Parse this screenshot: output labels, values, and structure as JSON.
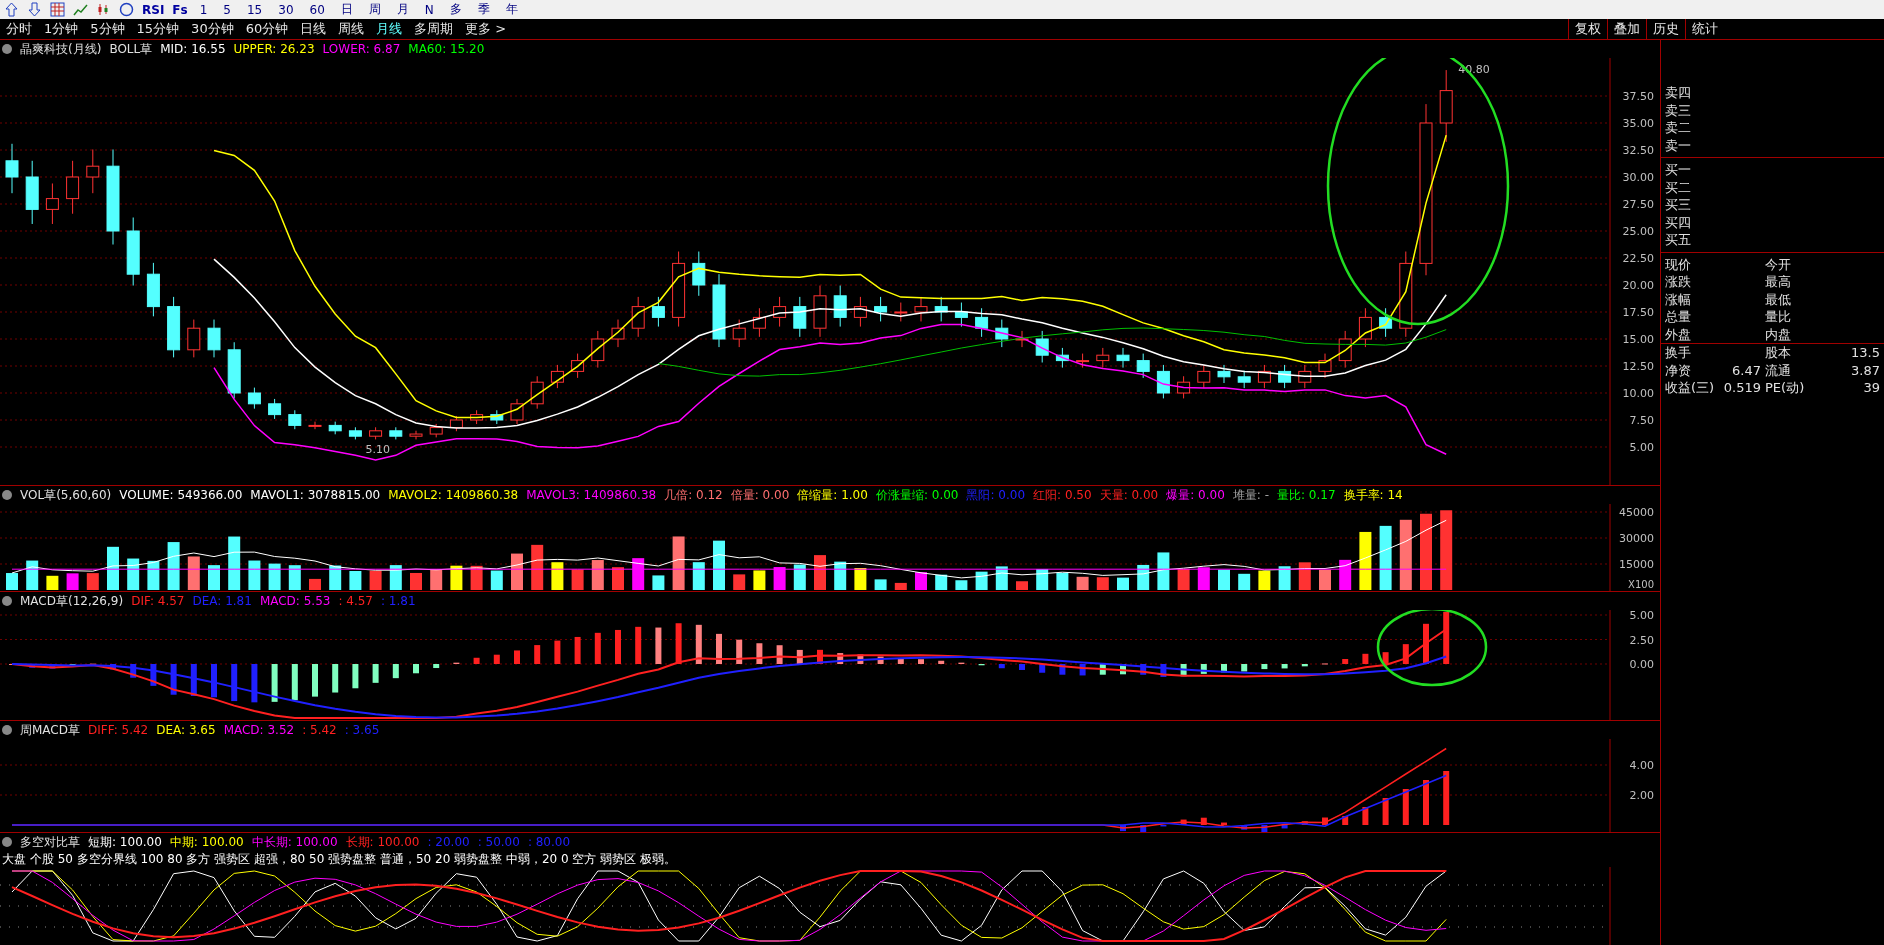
{
  "toolbar": {
    "labels": [
      "RSI",
      "Fs"
    ],
    "buttons": [
      "1",
      "5",
      "15",
      "30",
      "60",
      "日",
      "周",
      "月",
      "N",
      "多",
      "季",
      "年"
    ]
  },
  "periods": [
    {
      "label": "分时",
      "selected": false
    },
    {
      "label": "1分钟",
      "selected": false
    },
    {
      "label": "5分钟",
      "selected": false
    },
    {
      "label": "15分钟",
      "selected": false
    },
    {
      "label": "30分钟",
      "selected": false
    },
    {
      "label": "60分钟",
      "selected": false
    },
    {
      "label": "日线",
      "selected": false
    },
    {
      "label": "周线",
      "selected": false
    },
    {
      "label": "月线",
      "selected": true
    },
    {
      "label": "多周期",
      "selected": false
    },
    {
      "label": "更多 >",
      "selected": false
    }
  ],
  "right_tabs": [
    "复权",
    "叠加",
    "历史",
    "统计"
  ],
  "main_chart": {
    "stock": "晶爽科技(月线)",
    "indicator": "BOLL草",
    "values": [
      {
        "text": "MID: 16.55",
        "color": "#ffffff"
      },
      {
        "text": "UPPER: 26.23",
        "color": "#ffff00"
      },
      {
        "text": "LOWER: 6.87",
        "color": "#ff00ff"
      },
      {
        "text": "MA60: 15.20",
        "color": "#00ff00"
      }
    ],
    "high_label": "40.80",
    "low_label": "5.10",
    "axis": [
      "37.50",
      "35.00",
      "32.50",
      "30.00",
      "27.50",
      "25.00",
      "22.50",
      "20.00",
      "17.50",
      "15.00",
      "12.50",
      "10.00",
      "7.50",
      "5.00"
    ]
  },
  "volume": {
    "indicator": "VOL草(5,60,60)",
    "values": [
      {
        "text": "VOLUME: 549366.00",
        "color": "#ffffff"
      },
      {
        "text": "MAVOL1: 3078815.00",
        "color": "#ffffff"
      },
      {
        "text": "MAVOL2: 1409860.38",
        "color": "#ffff00"
      },
      {
        "text": "MAVOL3: 1409860.38",
        "color": "#ff00ff"
      },
      {
        "text": "几倍: 0.12",
        "color": "#ff6f6f"
      },
      {
        "text": "倍量: 0.00",
        "color": "#ff6f6f"
      },
      {
        "text": "倍缩量: 1.00",
        "color": "#ffff00"
      },
      {
        "text": "价涨量缩: 0.00",
        "color": "#00ff00"
      },
      {
        "text": "黑阳: 0.00",
        "color": "#2020ff"
      },
      {
        "text": "红阳: 0.50",
        "color": "#ff2020"
      },
      {
        "text": "天量: 0.00",
        "color": "#ff2020"
      },
      {
        "text": "爆量: 0.00",
        "color": "#ff00ff"
      },
      {
        "text": "堆量: -",
        "color": "#a0a0a0"
      },
      {
        "text": "量比: 0.17",
        "color": "#00ff00"
      },
      {
        "text": "换手率: 14",
        "color": "#ffff00"
      }
    ],
    "axis": [
      "45000",
      "30000",
      "15000"
    ],
    "unit": "X100"
  },
  "macd": {
    "indicator": "MACD草(12,26,9)",
    "values": [
      {
        "text": "DIF: 4.57",
        "color": "#ff2020"
      },
      {
        "text": "DEA: 1.81",
        "color": "#2020ff"
      },
      {
        "text": "MACD: 5.53",
        "color": "#ff00ff"
      },
      {
        "text": ": 4.57",
        "color": "#ff2020"
      },
      {
        "text": ": 1.81",
        "color": "#2020ff"
      }
    ],
    "axis": [
      "5.00",
      "2.50",
      "0.00"
    ]
  },
  "weekly_macd": {
    "indicator": "周MACD草",
    "values": [
      {
        "text": "DIFF: 5.42",
        "color": "#ff2020"
      },
      {
        "text": "DEA: 3.65",
        "color": "#ffff00"
      },
      {
        "text": "MACD: 3.52",
        "color": "#ff00ff"
      },
      {
        "text": ": 5.42",
        "color": "#ff2020"
      },
      {
        "text": ": 3.65",
        "color": "#2020ff"
      }
    ],
    "axis": [
      "4.00",
      "2.00"
    ]
  },
  "long_short": {
    "indicator": "多空对比草",
    "values": [
      {
        "text": "短期: 100.00",
        "color": "#ffffff"
      },
      {
        "text": "中期: 100.00",
        "color": "#ffff00"
      },
      {
        "text": "中长期: 100.00",
        "color": "#ff00ff"
      },
      {
        "text": "长期: 100.00",
        "color": "#ff2020"
      },
      {
        "text": ": 20.00",
        "color": "#2020ff"
      },
      {
        "text": ": 50.00",
        "color": "#2020ff"
      },
      {
        "text": ": 80.00",
        "color": "#2020ff"
      }
    ],
    "note": "大盘 个股 50 多空分界线 100 80 多方 强势区 超强，80 50 强势盘整 普通，50 20 弱势盘整 中弱，20 0 空方 弱势区 极弱。"
  },
  "order_book": {
    "sell": [
      "卖四",
      "卖三",
      "卖二",
      "卖一"
    ],
    "buy": [
      "买一",
      "买二",
      "买三",
      "买四",
      "买五"
    ]
  },
  "quote": [
    {
      "left": "现价",
      "right": "今开"
    },
    {
      "left": "涨跌",
      "right": "最高"
    },
    {
      "left": "涨幅",
      "right": "最低"
    },
    {
      "left": "总量",
      "right": "量比"
    },
    {
      "left": "外盘",
      "right": "内盘"
    },
    {
      "left": "换手",
      "right": "股本",
      "right_value": "13.5"
    },
    {
      "left": "净资",
      "left_value": "6.47",
      "right": "流通",
      "right_value": "3.87"
    },
    {
      "left": "收益(三)",
      "left_value": "0.519",
      "right": "PE(动)",
      "right_value": "39"
    }
  ]
}
